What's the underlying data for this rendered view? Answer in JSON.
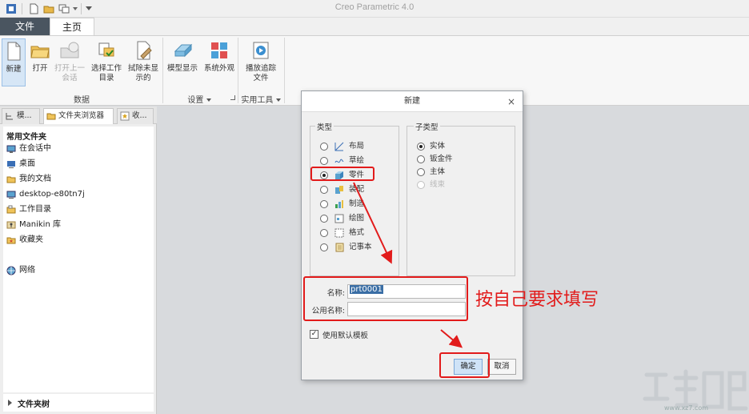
{
  "titlebar": {
    "app_title": "Creo Parametric 4.0"
  },
  "ribbon_tabs": {
    "file": "文件",
    "home": "主页"
  },
  "ribbon": {
    "new": "新建",
    "open": "打开",
    "open_last_line1": "打开上一",
    "open_last_line2": "会话",
    "select_dir_line1": "选择工作",
    "select_dir_line2": "目录",
    "erase_line1": "拭除未显",
    "erase_line2": "示的",
    "model_display": "模型显示",
    "system_appearance": "系统外观",
    "playback_line1": "播放追踪",
    "playback_line2": "文件",
    "group_data": "数据",
    "group_settings": "设置",
    "group_utilities": "实用工具"
  },
  "navigator": {
    "tabs": [
      "模...",
      "文件夹浏览器",
      "收..."
    ],
    "header": "常用文件夹",
    "items": [
      "在会话中",
      "桌面",
      "我的文档",
      "desktop-e80tn7j",
      "工作目录",
      "Manikin 库",
      "收藏夹",
      "网络"
    ],
    "footer": "文件夹树"
  },
  "dialog": {
    "title": "新建",
    "close": "×",
    "type_legend": "类型",
    "subtype_legend": "子类型",
    "types": [
      "布局",
      "草绘",
      "零件",
      "装配",
      "制造",
      "绘图",
      "格式",
      "记事本"
    ],
    "type_selected": "零件",
    "subtypes": [
      "实体",
      "钣金件",
      "主体",
      "线束"
    ],
    "subtype_selected": "实体",
    "name_label": "名称:",
    "name_value": "prt0001",
    "common_name_label": "公用名称:",
    "common_name_value": "",
    "use_default_template": "使用默认模板",
    "ok": "确定",
    "cancel": "取消"
  },
  "annotation": {
    "text": "按自己要求填写",
    "color": "#e21b1b"
  },
  "colors": {
    "accent_red": "#e21b1b",
    "file_tab": "#4a5560",
    "selection": "#3a6ea5"
  },
  "watermark": {
    "url": "www.xz7.com"
  }
}
